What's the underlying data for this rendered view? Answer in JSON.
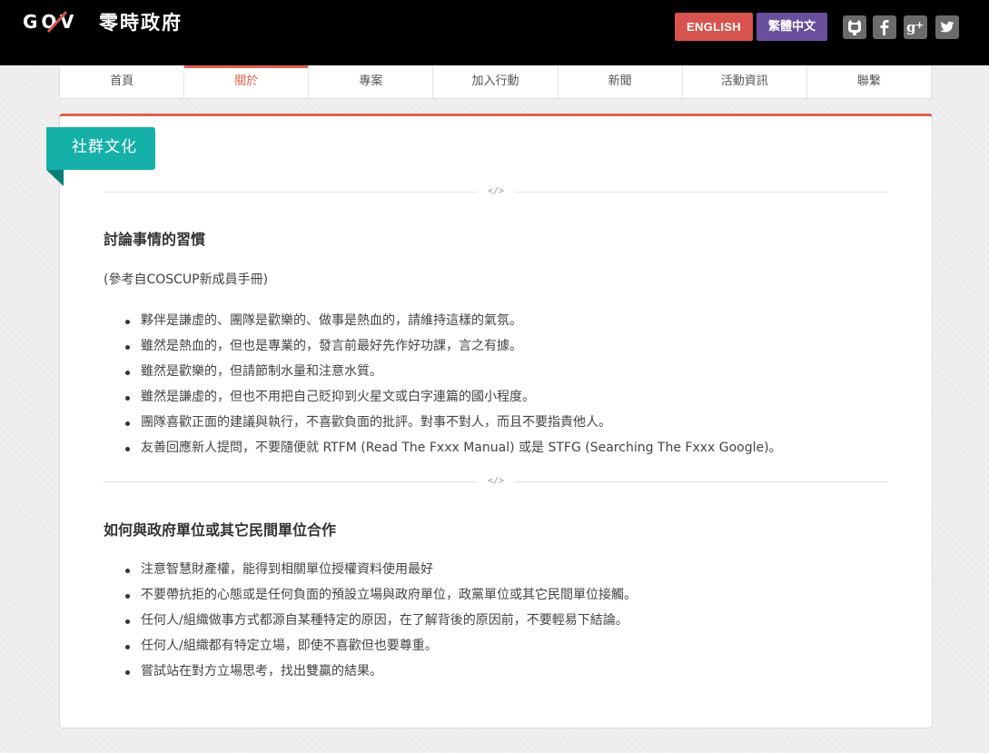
{
  "header": {
    "logo_text": "零時政府",
    "logo_mark_alt": "GOV",
    "lang_en": "ENGLISH",
    "lang_zh": "繁體中文",
    "social": [
      "github-icon",
      "facebook-icon",
      "google-plus-icon",
      "twitter-icon"
    ]
  },
  "nav": {
    "items": [
      "首頁",
      "關於",
      "專案",
      "加入行動",
      "新聞",
      "活動資訊",
      "聯繫"
    ],
    "active_index": 1
  },
  "page": {
    "ribbon_title": "社群文化",
    "divider_symbol": "</>",
    "sections": [
      {
        "title": "討論事情的習慣",
        "reference": "(參考自COSCUP新成員手冊)",
        "items": [
          "夥伴是謙虛的、團隊是歡樂的、做事是熱血的，請維持這樣的氣氛。",
          "雖然是熱血的，但也是專業的，發言前最好先作好功課，言之有據。",
          "雖然是歡樂的，但請節制水量和注意水質。",
          "雖然是謙虛的，但也不用把自己貶抑到火星文或白字連篇的國小程度。",
          "團隊喜歡正面的建議與執行，不喜歡負面的批評。對事不對人，而且不要指責他人。",
          "友善回應新人提問，不要隨便就 RTFM (Read The Fxxx Manual) 或是 STFG (Searching The Fxxx Google)。"
        ]
      },
      {
        "title": "如何與政府單位或其它民間單位合作",
        "items": [
          "注意智慧財產權，能得到相關單位授權資料使用最好",
          "不要帶抗拒的心態或是任何負面的預設立場與政府單位，政黨單位或其它民間單位接觸。",
          "任何人/組織做事方式都源自某種特定的原因，在了解背後的原因前，不要輕易下結論。",
          "任何人/組織都有特定立場，即使不喜歡但也要尊重。",
          "嘗試站在對方立場思考，找出雙贏的結果。"
        ]
      }
    ]
  },
  "colors": {
    "header_bg": "#000000",
    "accent": "#e0604e",
    "english_button": "#d9534f",
    "chinese_button": "#6a4f9e",
    "ribbon": "#15b0a8"
  }
}
